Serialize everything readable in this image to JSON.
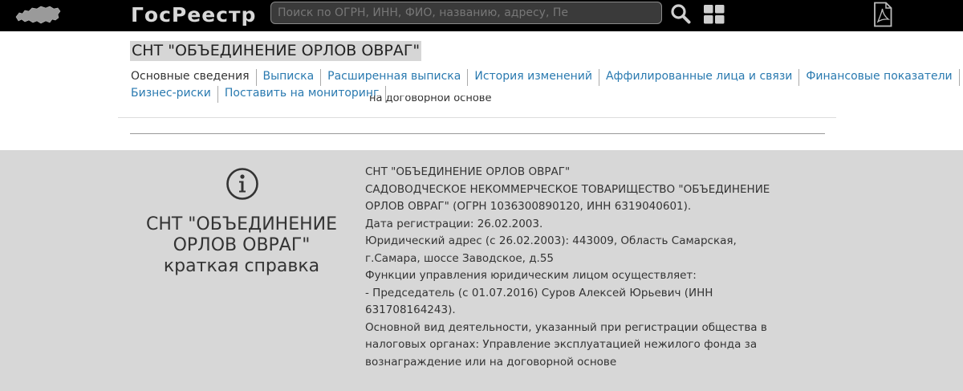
{
  "header": {
    "brand": "ГосРеестр",
    "search_placeholder": "Поиск по ОГРН, ИНН, ФИО, названию, адресу, Пе",
    "search_icon": "search-icon",
    "grid_icon": "grid-icon",
    "pdf_icon": "pdf-icon",
    "logo_icon": "russia-map-icon"
  },
  "company": {
    "title": "СНТ \"ОБЪЕДИНЕНИЕ ОРЛОВ ОВРАГ\""
  },
  "tabs": {
    "row1": [
      {
        "label": "Основные сведения",
        "active": true
      },
      {
        "label": "Выписка"
      },
      {
        "label": "Расширенная выписка"
      },
      {
        "label": "История изменений"
      },
      {
        "label": "Аффилированные лица и связи"
      },
      {
        "label": "Финансовые показатели"
      }
    ],
    "row2": [
      {
        "label": "Бизнес-риски"
      },
      {
        "label": "Поставить на мониторинг"
      }
    ]
  },
  "clipped_line": "на договорной основе",
  "summary": {
    "title_line1": "СНТ \"ОБЪЕДИНЕНИЕ",
    "title_line2": "ОРЛОВ ОВРАГ\"",
    "subtitle": "краткая справка",
    "lines": [
      "СНТ \"ОБЪЕДИНЕНИЕ ОРЛОВ ОВРАГ\"",
      "САДОВОДЧЕСКОЕ НЕКОММЕРЧЕСКОЕ ТОВАРИЩЕСТВО \"ОБЪЕДИНЕНИЕ",
      "ОРЛОВ ОВРАГ\" (ОГРН 1036300890120, ИНН 6319040601).",
      "Дата регистрации: 26.02.2003.",
      "Юридический адрес (с 26.02.2003): 443009, Область Самарская,",
      "г.Самара, шоссе Заводское, д.55",
      "Функции управления юридическим лицом осуществляет:",
      "- Председатель (с 01.07.2016) Суров Алексей Юрьевич (ИНН",
      "631708164243).",
      "Основной вид деятельности, указанный при регистрации общества в",
      "налоговых органах: Управление эксплуатацией нежилого фонда за",
      "вознаграждение или на договорной основе"
    ]
  }
}
